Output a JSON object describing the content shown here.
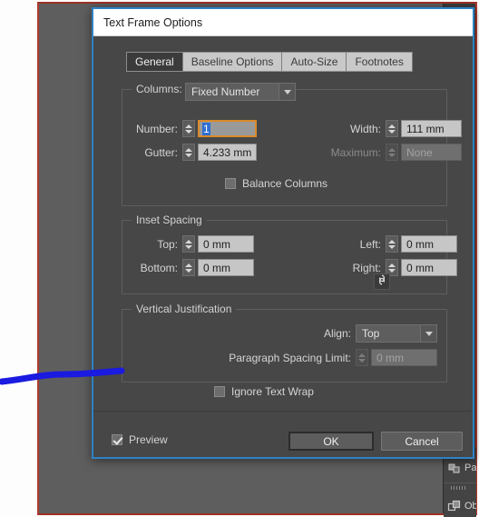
{
  "dialog": {
    "title": "Text Frame Options",
    "tabs": [
      {
        "label": "General",
        "active": true
      },
      {
        "label": "Baseline Options",
        "active": false
      },
      {
        "label": "Auto-Size",
        "active": false
      },
      {
        "label": "Footnotes",
        "active": false
      }
    ],
    "columns": {
      "legend": "Columns:",
      "type_value": "Fixed Number",
      "number_label": "Number:",
      "number_value": "1",
      "width_label": "Width:",
      "width_value": "111 mm",
      "gutter_label": "Gutter:",
      "gutter_value": "4.233 mm",
      "maximum_label": "Maximum:",
      "maximum_value": "None",
      "balance_label": "Balance Columns",
      "balance_checked": false
    },
    "inset": {
      "legend": "Inset Spacing",
      "top_label": "Top:",
      "top_value": "0 mm",
      "bottom_label": "Bottom:",
      "bottom_value": "0 mm",
      "left_label": "Left:",
      "left_value": "0 mm",
      "right_label": "Right:",
      "right_value": "0 mm",
      "link_icon": "chain-link-icon"
    },
    "vertical": {
      "legend": "Vertical Justification",
      "align_label": "Align:",
      "align_value": "Top",
      "spacing_label": "Paragraph Spacing Limit:",
      "spacing_value": "0 mm"
    },
    "ignore_text_wrap": {
      "label": "Ignore Text Wrap",
      "checked": false
    },
    "footer": {
      "preview_label": "Preview",
      "preview_checked": true,
      "ok_label": "OK",
      "cancel_label": "Cancel"
    }
  },
  "right_dock": {
    "items": [
      {
        "label": "Pathf",
        "icon": "pathfinder-icon"
      },
      {
        "label": "Obje",
        "icon": "object-styles-icon"
      }
    ]
  },
  "colors": {
    "accent_focus": "#d98a2b",
    "selection": "#2f6fd0",
    "dialog_border": "#2f82c4",
    "app_border": "#b03a2e",
    "annotation": "#1a1ae0",
    "dialog_bg": "#474747",
    "field_bg": "#c6c6c6"
  }
}
